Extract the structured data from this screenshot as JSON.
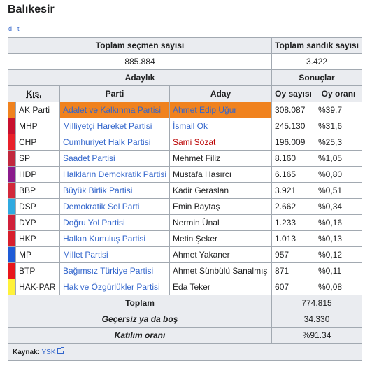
{
  "title": "Balıkesir",
  "navbox": {
    "view": "d",
    "sep": "·",
    "talk": "t"
  },
  "summary": {
    "voters_label": "Toplam seçmen sayısı",
    "ballot_boxes_label": "Toplam sandık sayısı",
    "voters_value": "885.884",
    "ballot_boxes_value": "3.422"
  },
  "headers": {
    "candidacy": "Adaylık",
    "results": "Sonuçlar",
    "abbr": "Kıs.",
    "party": "Parti",
    "candidate": "Aday",
    "votes": "Oy sayısı",
    "percent": "Oy oranı"
  },
  "rows": [
    {
      "abbr": "AK Parti",
      "party": "Adalet ve Kalkınma Partisi",
      "candidate": "Ahmet Edip Uğur",
      "votes": "308.087",
      "percent": "%39,7",
      "color": "#f0821e",
      "party_link": true,
      "cand_style": "link",
      "highlight": true
    },
    {
      "abbr": "MHP",
      "party": "Milliyetçi Hareket Partisi",
      "candidate": "İsmail Ok",
      "votes": "245.130",
      "percent": "%31,6",
      "color": "#c8102e",
      "party_link": true,
      "cand_style": "link"
    },
    {
      "abbr": "CHP",
      "party": "Cumhuriyet Halk Partisi",
      "candidate": "Sami Sözat",
      "votes": "196.009",
      "percent": "%25,3",
      "color": "#e8202a",
      "party_link": true,
      "cand_style": "red"
    },
    {
      "abbr": "SP",
      "party": "Saadet Partisi",
      "candidate": "Mehmet Filiz",
      "votes": "8.160",
      "percent": "%1,05",
      "color": "#c2273d",
      "party_link": true,
      "cand_style": "plain"
    },
    {
      "abbr": "HDP",
      "party": "Halkların Demokratik Partisi",
      "candidate": "Mustafa Hasırcı",
      "votes": "6.165",
      "percent": "%0,80",
      "color": "#8a1b8c",
      "party_link": true,
      "cand_style": "plain"
    },
    {
      "abbr": "BBP",
      "party": "Büyük Birlik Partisi",
      "candidate": "Kadir Geraslan",
      "votes": "3.921",
      "percent": "%0,51",
      "color": "#d2283a",
      "party_link": true,
      "cand_style": "plain"
    },
    {
      "abbr": "DSP",
      "party": "Demokratik Sol Parti",
      "candidate": "Emin Baytaş",
      "votes": "2.662",
      "percent": "%0,34",
      "color": "#2fa9e0",
      "party_link": true,
      "cand_style": "plain"
    },
    {
      "abbr": "DYP",
      "party": "Doğru Yol Partisi",
      "candidate": "Nermin Ünal",
      "votes": "1.233",
      "percent": "%0,16",
      "color": "#d0203a",
      "party_link": true,
      "cand_style": "plain"
    },
    {
      "abbr": "HKP",
      "party": "Halkın Kurtuluş Partisi",
      "candidate": "Metin Şeker",
      "votes": "1.013",
      "percent": "%0,13",
      "color": "#d81e2c",
      "party_link": true,
      "cand_style": "plain"
    },
    {
      "abbr": "MP",
      "party": "Millet Partisi",
      "candidate": "Ahmet Yakaner",
      "votes": "957",
      "percent": "%0,12",
      "color": "#1e5bd6",
      "party_link": true,
      "cand_style": "plain"
    },
    {
      "abbr": "BTP",
      "party": "Bağımsız Türkiye Partisi",
      "candidate": "Ahmet Sünbülü Sanalmış",
      "votes": "871",
      "percent": "%0,11",
      "color": "#e8161b",
      "party_link": true,
      "cand_style": "plain"
    },
    {
      "abbr": "HAK-PAR",
      "party": "Hak ve Özgürlükler Partisi",
      "candidate": "Eda Teker",
      "votes": "607",
      "percent": "%0,08",
      "color": "#fff23a",
      "party_link": true,
      "cand_style": "plain"
    }
  ],
  "totals": [
    {
      "label": "Toplam",
      "value": "774.815",
      "italic": false
    },
    {
      "label": "Geçersiz ya da boş",
      "value": "34.330",
      "italic": true
    },
    {
      "label": "Katılım oranı",
      "value": "%91.34",
      "italic": true
    }
  ],
  "source": {
    "label": "Kaynak:",
    "link": "YSK"
  }
}
